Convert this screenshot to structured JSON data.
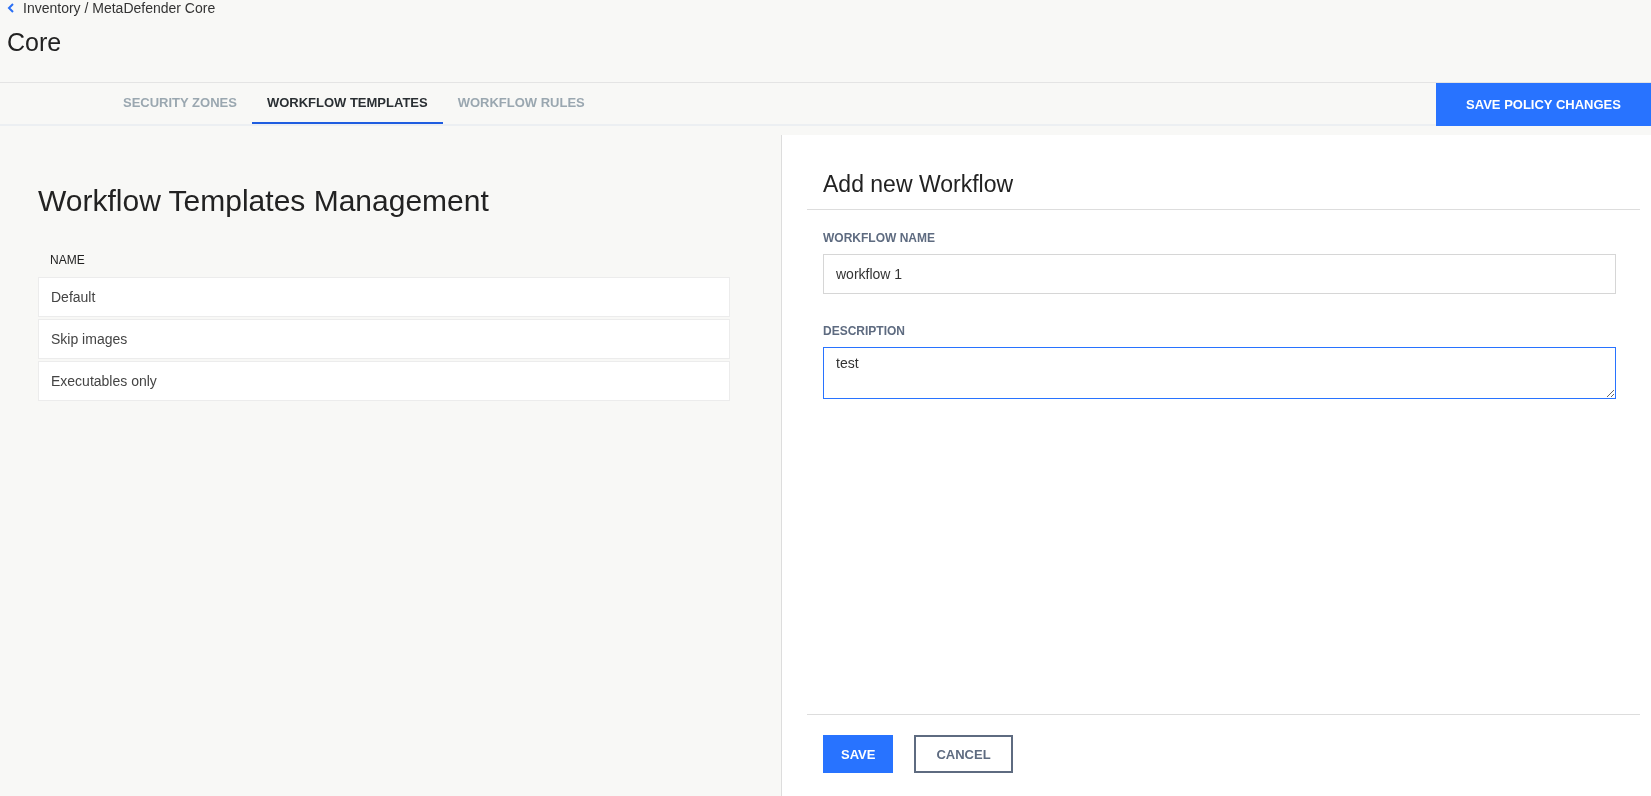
{
  "breadcrumb": "Inventory / MetaDefender Core",
  "page_title": "Core",
  "tabs": [
    {
      "label": "SECURITY ZONES",
      "selected": false
    },
    {
      "label": "WORKFLOW TEMPLATES",
      "selected": true
    },
    {
      "label": "WORKFLOW RULES",
      "selected": false
    }
  ],
  "save_policy_button": "SAVE POLICY CHANGES",
  "templates": {
    "title": "Workflow Templates Management",
    "column": "NAME",
    "rows": [
      "Default",
      "Skip images",
      "Executables only"
    ]
  },
  "form": {
    "title": "Add new Workflow",
    "fields": [
      {
        "label": "WORKFLOW NAME",
        "kind": "input",
        "value": "workflow 1",
        "focused": false
      },
      {
        "label": "DESCRIPTION",
        "kind": "textarea",
        "value": "test",
        "focused": true
      }
    ],
    "buttons": [
      {
        "label": "SAVE",
        "kind": "primary"
      },
      {
        "label": "CANCEL",
        "kind": "outline"
      }
    ]
  }
}
